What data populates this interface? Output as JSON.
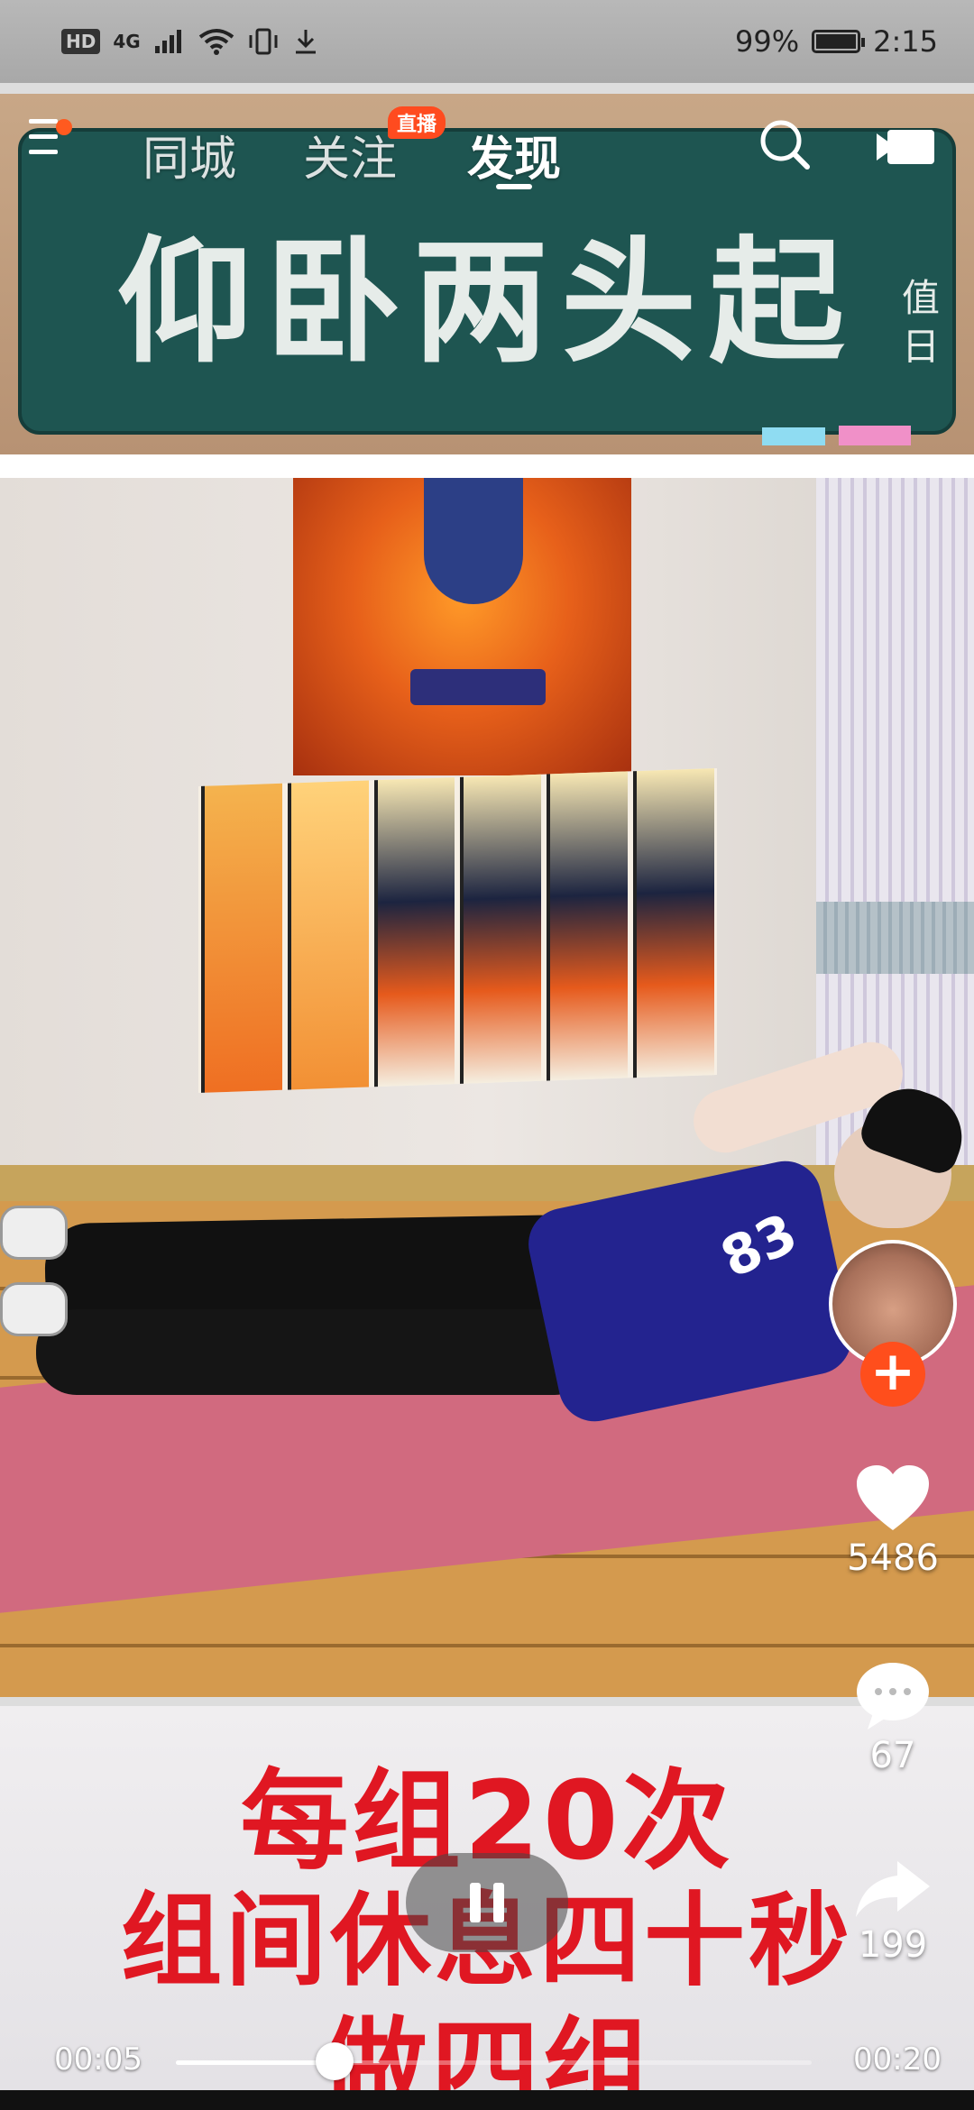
{
  "status_bar": {
    "hd": "HD",
    "network": "4G",
    "battery_percent": "99%",
    "time": "2:15"
  },
  "nav": {
    "tabs": [
      {
        "label": "同城"
      },
      {
        "label": "关注"
      },
      {
        "label": "发现"
      }
    ],
    "active_tab": "发现",
    "live_badge": "直播"
  },
  "video": {
    "board_title": "仰卧两头起",
    "board_side": "值日",
    "caption_lines": [
      "每组20次",
      "组间休息四十秒",
      "做四组"
    ],
    "shirt_number": "83"
  },
  "actions": {
    "likes": "5486",
    "comments": "67",
    "shares": "199"
  },
  "player": {
    "current_time": "00:05",
    "duration": "00:20",
    "progress_fraction": 0.25
  },
  "colors": {
    "accent": "#ff4e1c",
    "caption": "#e01722"
  }
}
